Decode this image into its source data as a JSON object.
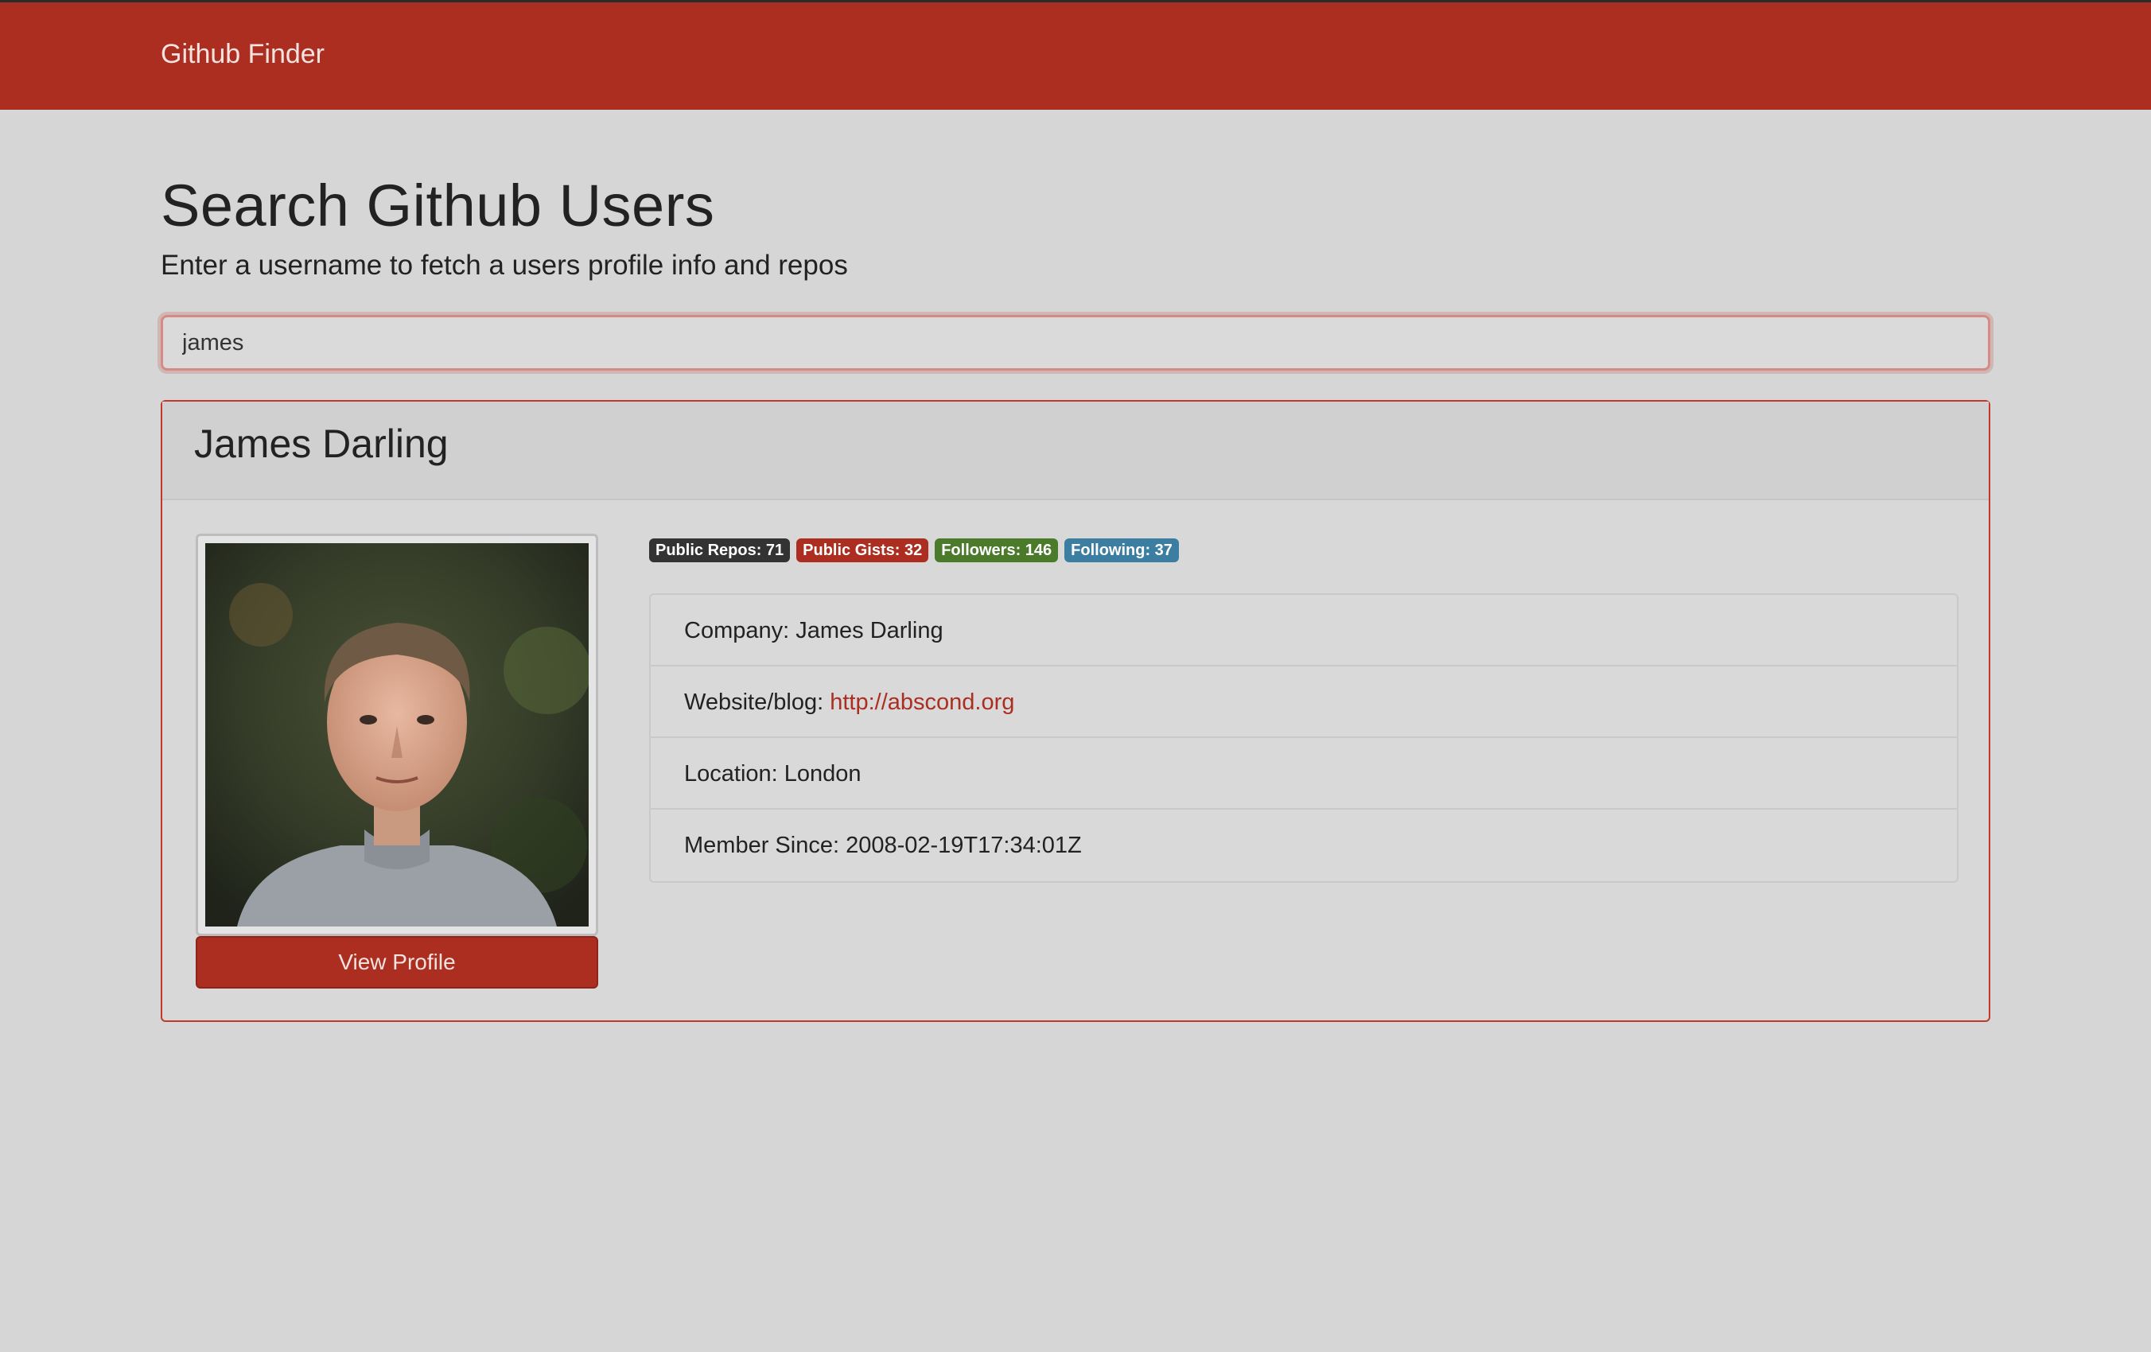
{
  "navbar": {
    "brand": "Github Finder"
  },
  "search": {
    "heading": "Search Github Users",
    "subheading": "Enter a username to fetch a users profile info and repos",
    "value": "james"
  },
  "profile": {
    "name": "James Darling",
    "view_profile_label": "View Profile",
    "badges": {
      "repos": "Public Repos: 71",
      "gists": "Public Gists: 32",
      "followers": "Followers: 146",
      "following": "Following: 37"
    },
    "company_label": "Company: ",
    "company": "James Darling",
    "website_label": "Website/blog: ",
    "website": "http://abscond.org",
    "location_label": "Location: ",
    "location": "London",
    "member_since_label": "Member Since: ",
    "member_since": "2008-02-19T17:34:01Z"
  },
  "colors": {
    "brand": "#ab2e20",
    "background": "#d6d6d6",
    "badge_repos": "#333333",
    "badge_gists": "#ab2e20",
    "badge_followers": "#4a7a2a",
    "badge_following": "#3b7ea1"
  }
}
